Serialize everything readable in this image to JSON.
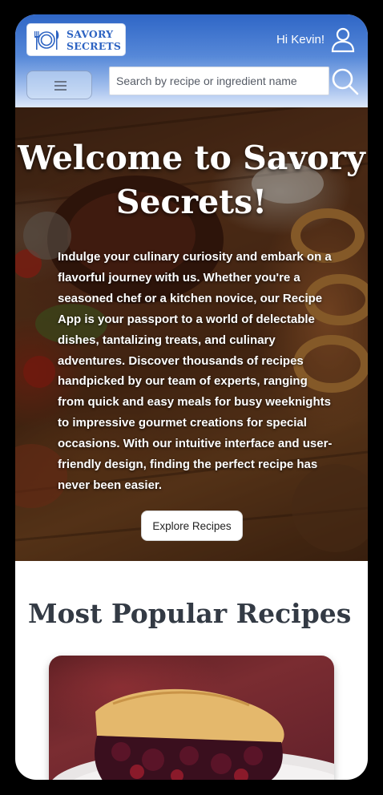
{
  "header": {
    "logo_line1": "SAVORY",
    "logo_line2": "SECRETS",
    "logo_icon": "plate-fork-knife-icon",
    "greeting": "Hi Kevin!",
    "user_icon": "user-icon",
    "menu_icon": "hamburger-menu-icon",
    "search_placeholder": "Search by recipe or ingredient name",
    "search_value": "",
    "search_icon": "search-icon"
  },
  "hero": {
    "title": "Welcome to Savory Secrets!",
    "body": "Indulge your culinary curiosity and embark on a flavorful journey with us. Whether you're a seasoned chef or a kitchen novice, our Recipe App is your passport to a world of delectable dishes, tantalizing treats, and culinary adventures. Discover thousands of recipes handpicked by our team of experts, ranging from quick and easy meals for busy weeknights to impressive gourmet creations for special occasions. With our intuitive interface and user-friendly design, finding the perfect recipe has never been easier.",
    "button_label": "Explore Recipes"
  },
  "popular": {
    "title": "Most Popular Recipes"
  },
  "colors": {
    "header_blue": "#2f66c6",
    "logo_blue": "#2d63c2",
    "title_dark": "#333a44"
  }
}
